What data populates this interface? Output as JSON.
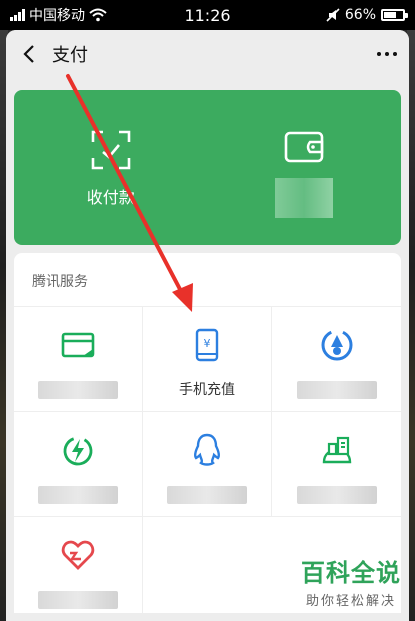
{
  "status_bar": {
    "carrier": "中国移动",
    "time": "11:26",
    "battery": "66%",
    "battery_level": 0.66
  },
  "nav": {
    "title": "支付"
  },
  "pay_card": {
    "receive_label": "收付款"
  },
  "services": {
    "section_title": "腾讯服务",
    "items": [
      {
        "label": "",
        "icon": "card-icon"
      },
      {
        "label": "手机充值",
        "icon": "phone-topup-icon"
      },
      {
        "label": "",
        "icon": "wealth-icon"
      },
      {
        "label": "",
        "icon": "energy-icon"
      },
      {
        "label": "",
        "icon": "qq-icon"
      },
      {
        "label": "",
        "icon": "city-service-icon"
      },
      {
        "label": "",
        "icon": "charity-icon"
      }
    ]
  },
  "colors": {
    "accent_green": "#3cab5f",
    "icon_green": "#1aad5a",
    "icon_blue": "#2c7fe0",
    "charity_red": "#e5484d",
    "arrow_red": "#e8312a"
  },
  "watermark": {
    "main": "百科全说",
    "sub": "助你轻松解决"
  }
}
